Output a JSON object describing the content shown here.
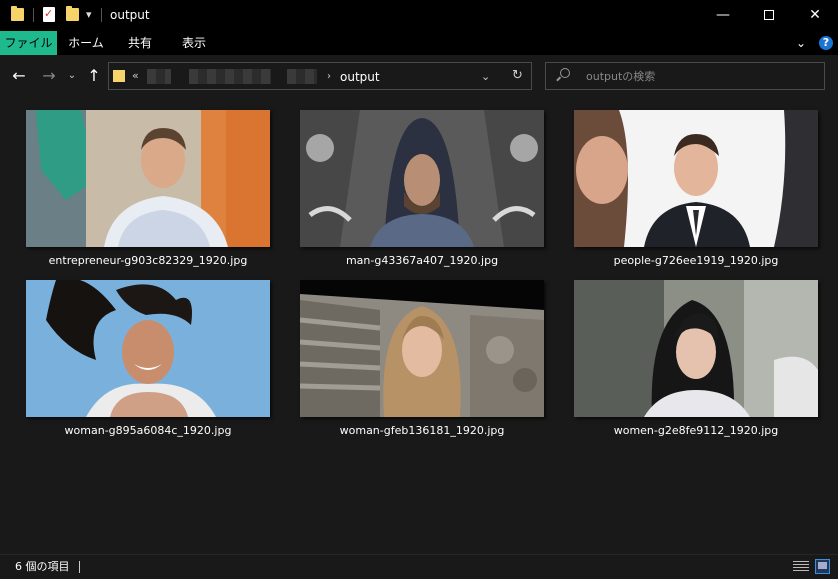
{
  "window": {
    "title": "output",
    "controls": {
      "minimize": "—",
      "maximize": "",
      "close": "✕"
    }
  },
  "quick_access": {
    "dropdown_glyph": "▾"
  },
  "ribbon": {
    "tabs": [
      {
        "label": "ファイル",
        "active": true
      },
      {
        "label": "ホーム"
      },
      {
        "label": "共有"
      },
      {
        "label": "表示"
      }
    ],
    "collapse_glyph": "⌄",
    "help_glyph": "?"
  },
  "navigation": {
    "back_glyph": "←",
    "forward_glyph": "→",
    "recent_glyph": "⌄",
    "up_glyph": "↑"
  },
  "address": {
    "overflow": "«",
    "separator": "›",
    "current": "output",
    "dropdown_glyph": "⌄",
    "refresh_glyph": "↻"
  },
  "search": {
    "placeholder": "outputの検索",
    "value": ""
  },
  "files": [
    {
      "name": "entrepreneur-g903c82329_1920.jpg"
    },
    {
      "name": "man-g43367a407_1920.jpg"
    },
    {
      "name": "people-g726ee1919_1920.jpg"
    },
    {
      "name": "woman-g895a6084c_1920.jpg"
    },
    {
      "name": "woman-gfeb136181_1920.jpg"
    },
    {
      "name": "women-g2e8fe9112_1920.jpg"
    }
  ],
  "status": {
    "item_count": "6 個の項目"
  },
  "colors": {
    "accent": "#1eb98d",
    "background": "#191919",
    "titlebar": "#000000",
    "folder": "#f6d469",
    "help": "#1a75d2"
  },
  "icons": {
    "back": "arrow-left-icon",
    "forward": "arrow-right-icon",
    "up": "arrow-up-icon",
    "search": "search-icon",
    "refresh": "refresh-icon",
    "help": "help-icon",
    "details_view": "details-view-icon",
    "large_icons_view": "large-icons-view-icon"
  }
}
